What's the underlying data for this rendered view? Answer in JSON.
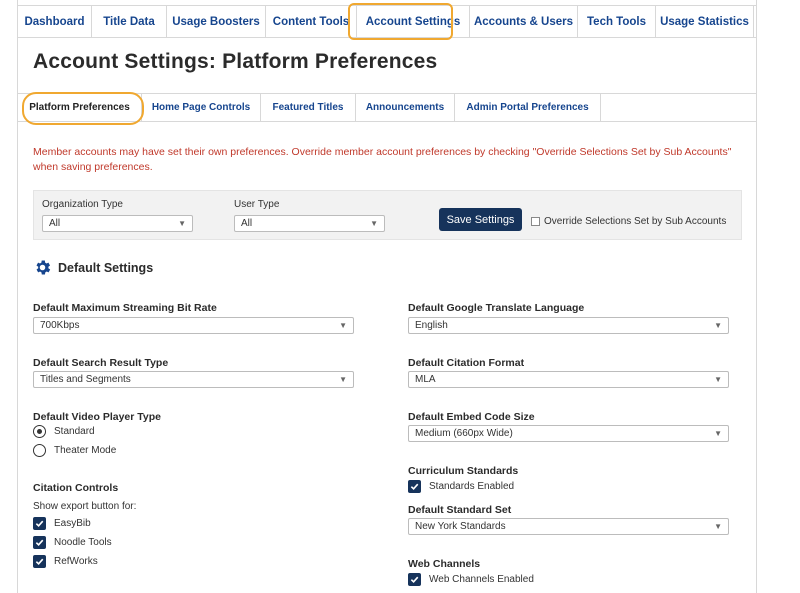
{
  "nav": {
    "tabs": [
      {
        "label": "Dashboard"
      },
      {
        "label": "Title Data"
      },
      {
        "label": "Usage Boosters"
      },
      {
        "label": "Content Tools"
      },
      {
        "label": "Account Settings"
      },
      {
        "label": "Accounts & Users"
      },
      {
        "label": "Tech Tools"
      },
      {
        "label": "Usage Statistics"
      }
    ],
    "active": "Account Settings"
  },
  "page": {
    "title": "Account Settings: Platform Preferences"
  },
  "subnav": {
    "tabs": [
      {
        "label": "Platform Preferences"
      },
      {
        "label": "Home Page Controls"
      },
      {
        "label": "Featured Titles"
      },
      {
        "label": "Announcements"
      },
      {
        "label": "Admin Portal Preferences"
      }
    ],
    "active": "Platform Preferences"
  },
  "notice": "Member accounts may have set their own preferences. Override member account preferences by checking \"Override Selections Set by Sub Accounts\" when saving preferences.",
  "filters": {
    "org_type_label": "Organization Type",
    "org_type_value": "All",
    "user_type_label": "User Type",
    "user_type_value": "All",
    "save_label": "Save Settings",
    "override_label": "Override Selections Set by Sub Accounts",
    "override_checked": false
  },
  "default_settings": {
    "title": "Default Settings",
    "bitrate": {
      "label": "Default Maximum Streaming Bit Rate",
      "value": "700Kbps"
    },
    "search_type": {
      "label": "Default Search Result Type",
      "value": "Titles and Segments"
    },
    "player": {
      "label": "Default Video Player Type",
      "options": [
        {
          "label": "Standard",
          "selected": true
        },
        {
          "label": "Theater Mode",
          "selected": false
        }
      ]
    },
    "citation_controls": {
      "label": "Citation Controls",
      "sublabel": "Show export button for:",
      "items": [
        {
          "label": "EasyBib",
          "checked": true
        },
        {
          "label": "Noodle Tools",
          "checked": true
        },
        {
          "label": "RefWorks",
          "checked": true
        }
      ]
    },
    "translate": {
      "label": "Default Google Translate Language",
      "value": "English"
    },
    "citation_format": {
      "label": "Default Citation Format",
      "value": "MLA"
    },
    "embed_size": {
      "label": "Default Embed Code Size",
      "value": "Medium (660px Wide)"
    },
    "curriculum": {
      "label": "Curriculum Standards",
      "item": "Standards Enabled",
      "checked": true
    },
    "standard_set": {
      "label": "Default Standard Set",
      "value": "New York Standards"
    },
    "web_channels": {
      "label": "Web Channels",
      "item": "Web Channels Enabled",
      "checked": true
    }
  },
  "colors": {
    "link": "#16458e",
    "notice": "#c0392b",
    "highlight": "#f0a830",
    "button": "#16335b"
  }
}
